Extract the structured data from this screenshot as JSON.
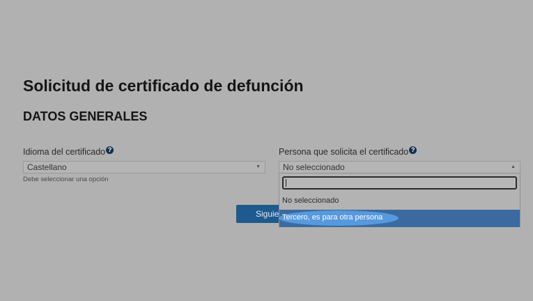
{
  "page": {
    "title": "Solicitud de certificado de defunción",
    "section_title": "DATOS GENERALES"
  },
  "form": {
    "language": {
      "label": "Idioma del certificado",
      "value": "Castellano",
      "help_text": "Debe seleccionar una opción"
    },
    "requester": {
      "label": "Persona que solicita el certificado",
      "value": "No seleccionado",
      "search_value": "",
      "options": [
        "No seleccionado",
        "Tercero, es para otra persona"
      ]
    },
    "help_icon": "?",
    "next_button_label": "Siguiente",
    "next_button_visible_text": "Siguie"
  },
  "colors": {
    "background": "#b1b1b1",
    "button": "#1e5a8e",
    "option_highlight": "#3a6aa0",
    "touch_highlight": "#5b9ee2"
  },
  "icons": {
    "help": "question-circle-icon",
    "dropdown": "caret-down-icon",
    "dropdown_open": "caret-up-icon"
  }
}
